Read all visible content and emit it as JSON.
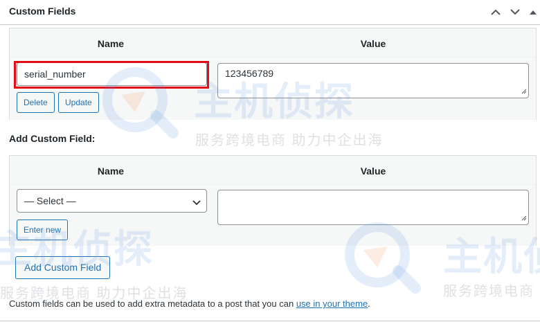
{
  "panel": {
    "title": "Custom Fields",
    "controls": [
      "chevron-up-icon",
      "chevron-down-icon",
      "triangle-up-icon"
    ]
  },
  "existing_fields": {
    "columns": [
      "Name",
      "Value"
    ],
    "rows": [
      {
        "name": "serial_number",
        "value": "123456789",
        "delete_label": "Delete",
        "update_label": "Update"
      }
    ]
  },
  "add_section": {
    "heading": "Add Custom Field:",
    "columns": [
      "Name",
      "Value"
    ],
    "select_value": "— Select —",
    "value": "",
    "enter_new_label": "Enter new",
    "submit_label": "Add Custom Field"
  },
  "footer": {
    "note_prefix": "Custom fields can be used to add extra metadata to a post that you can ",
    "link_text": "use in your theme",
    "note_suffix": "."
  },
  "watermark": {
    "title": "主机侦探",
    "tagline": "服务跨境电商 助力中企出海"
  },
  "colors": {
    "accent": "#2271b1",
    "highlight": "#e50914",
    "border": "#8c8f94"
  }
}
